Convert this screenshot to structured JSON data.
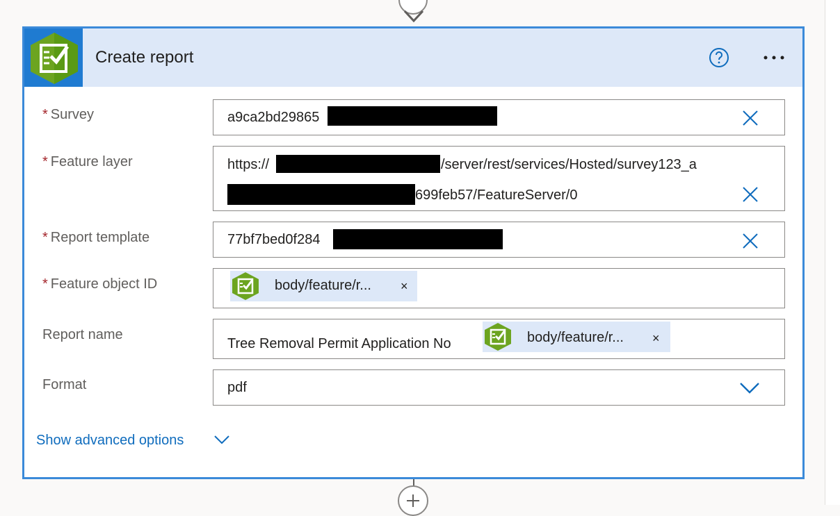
{
  "action": {
    "title": "Create report",
    "icon": "survey123-icon",
    "help_icon": "help-circle-icon",
    "more_icon": "more-ellipsis-icon"
  },
  "fields": {
    "survey": {
      "label": "Survey",
      "required": "*",
      "value": "a9ca2bd29865"
    },
    "feature_layer": {
      "label": "Feature layer",
      "required": "*",
      "value_line1": "https://",
      "value_line1_rest": "/server/rest/services/Hosted/survey123_a",
      "value_line2": "699feb57/FeatureServer/0"
    },
    "report_template": {
      "label": "Report template",
      "required": "*",
      "value": "77bf7bed0f284"
    },
    "feature_object_id": {
      "label": "Feature object ID",
      "required": "*",
      "token": "body/feature/r...",
      "token_remove": "×"
    },
    "report_name": {
      "label": "Report name",
      "prefix": "Tree Removal Permit Application No",
      "token": "body/feature/r...",
      "token_remove": "×"
    },
    "format": {
      "label": "Format",
      "value": "pdf"
    }
  },
  "advanced": {
    "label": "Show advanced options"
  },
  "colors": {
    "accent": "#0f6cbd",
    "border": "#3b8ad9",
    "header": "#dde8f8",
    "required": "#a4262c",
    "brand_green": "#6ca420"
  }
}
